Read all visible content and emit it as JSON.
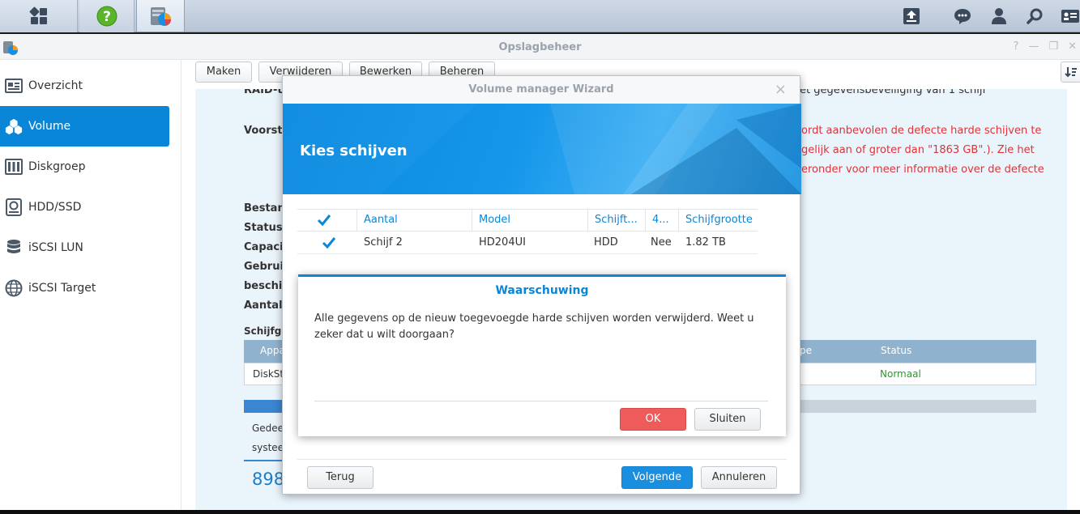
{
  "window": {
    "title": "Opslagbeheer"
  },
  "toolbar": {
    "create": "Maken",
    "delete": "Verwijderen",
    "edit": "Bewerken",
    "manage": "Beheren"
  },
  "sidebar": {
    "items": [
      {
        "label": "Overzicht",
        "icon": "overview-icon"
      },
      {
        "label": "Volume",
        "icon": "volume-cubes-icon",
        "active": true
      },
      {
        "label": "Diskgroep",
        "icon": "diskgroup-icon"
      },
      {
        "label": "HDD/SSD",
        "icon": "hdd-icon"
      },
      {
        "label": "iSCSI LUN",
        "icon": "database-icon"
      },
      {
        "label": "iSCSI Target",
        "icon": "globe-icon"
      }
    ]
  },
  "panel": {
    "raid_cut": "RAID-t",
    "protection_text": "et gegevensbeveiliging van 1 schijf",
    "warn_label": "Voorste",
    "red_line1": "ordt aanbevolen de defecte harde schijven te",
    "red_line2": "gelijk aan of groter dan \"1863 GB\".). Zie het",
    "red_line3": "eronder voor meer informatie over de defecte",
    "labels": [
      "Bestand",
      "Status",
      "Capacit",
      "Gebruik",
      "beschik",
      "Aantal"
    ],
    "disk_section": "Schijfge",
    "table_head_left": "Appa",
    "table_head_type": "pe",
    "table_head_status": "Status",
    "table_row_left": "DiskSt",
    "table_row_status": "Normaal",
    "shared_line1": "Gedee",
    "shared_line2": "systee",
    "big_number": "898"
  },
  "wizard": {
    "title": "Volume manager Wizard",
    "heading": "Kies schijven",
    "columns": [
      "Aantal",
      "Model",
      "Schijft...",
      "4...",
      "Schijfgrootte"
    ],
    "rows": [
      {
        "number": "Schijf 2",
        "model": "HD204UI",
        "type": "HDD",
        "4k": "Nee",
        "size": "1.82 TB"
      }
    ],
    "back": "Terug",
    "next": "Volgende",
    "cancel": "Annuleren"
  },
  "warning": {
    "title": "Waarschuwing",
    "message": "Alle gegevens op de nieuw toegevoegde harde schijven worden verwijderd. Weet u zeker dat u wilt doorgaan?",
    "ok": "OK",
    "close": "Sluiten"
  },
  "colors": {
    "accent": "#0a86d8",
    "warning_red": "#e1323a",
    "ok_button": "#ef5a5a",
    "status_ok": "#2a9a2a"
  }
}
